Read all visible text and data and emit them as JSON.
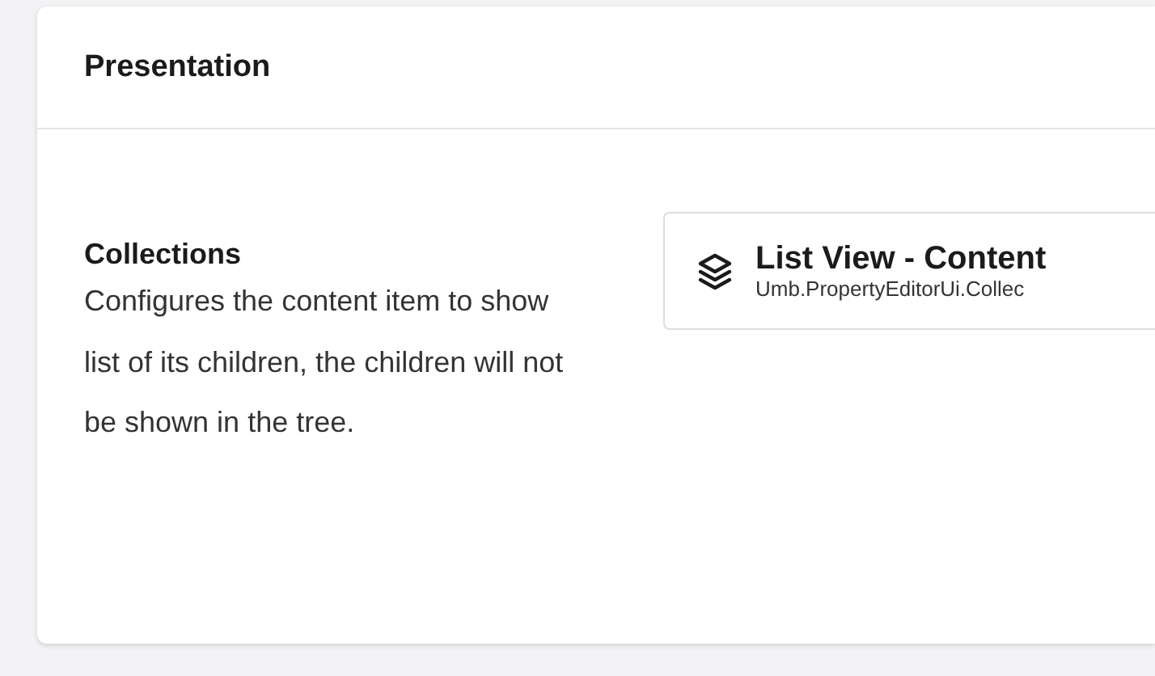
{
  "panel": {
    "title": "Presentation"
  },
  "property": {
    "label": "Collections",
    "description": "Configures the content item to show list of its children, the children will not be shown in the tree."
  },
  "picked_item": {
    "name": "List View - Content",
    "alias": "Umb.PropertyEditorUi.Collec"
  }
}
